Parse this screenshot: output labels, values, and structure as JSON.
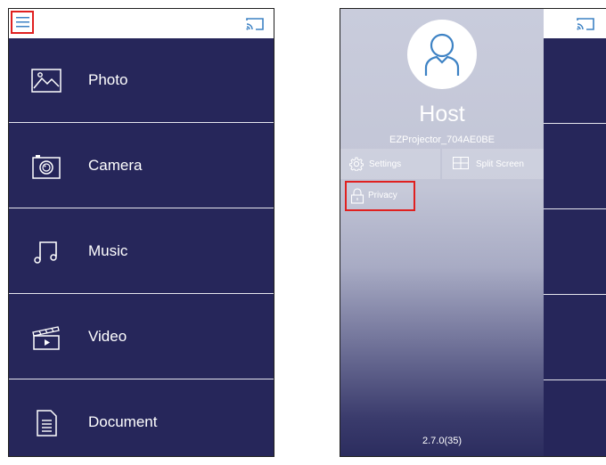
{
  "left_screen": {
    "items": [
      {
        "label": "Photo",
        "icon": "photo-icon"
      },
      {
        "label": "Camera",
        "icon": "camera-icon"
      },
      {
        "label": "Music",
        "icon": "music-icon"
      },
      {
        "label": "Video",
        "icon": "video-icon"
      },
      {
        "label": "Document",
        "icon": "document-icon"
      }
    ]
  },
  "right_screen": {
    "host_name": "Host",
    "device_name": "EZProjector_704AE0BE",
    "actions": {
      "settings": "Settings",
      "split_screen": "Split Screen",
      "privacy": "Privacy"
    },
    "version": "2.7.0(35)"
  },
  "colors": {
    "nav_background": "#26265a",
    "highlight": "#e02020",
    "icon_accent": "#3d82c4"
  }
}
